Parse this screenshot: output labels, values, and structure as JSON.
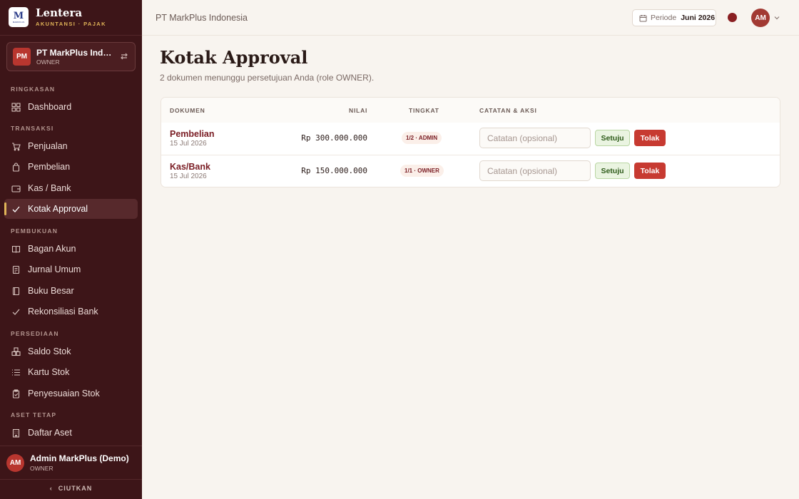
{
  "brand": {
    "logo_text": "M",
    "logo_sub": "MARKPLUS",
    "name": "Lentera",
    "subtitle": "AKUNTANSI · PAJAK"
  },
  "company": {
    "initials": "PM",
    "name": "PT MarkPlus Indonesia",
    "role": "OWNER"
  },
  "sidebar": {
    "sections": [
      {
        "label": "RINGKASAN",
        "items": [
          {
            "label": "Dashboard",
            "icon": "grid-icon"
          }
        ]
      },
      {
        "label": "TRANSAKSI",
        "items": [
          {
            "label": "Penjualan",
            "icon": "cart-icon"
          },
          {
            "label": "Pembelian",
            "icon": "bag-icon"
          },
          {
            "label": "Kas / Bank",
            "icon": "wallet-icon"
          },
          {
            "label": "Kotak Approval",
            "icon": "check-icon",
            "active": true
          }
        ]
      },
      {
        "label": "PEMBUKUAN",
        "items": [
          {
            "label": "Bagan Akun",
            "icon": "book-icon"
          },
          {
            "label": "Jurnal Umum",
            "icon": "document-icon"
          },
          {
            "label": "Buku Besar",
            "icon": "ledger-icon"
          },
          {
            "label": "Rekonsiliasi Bank",
            "icon": "check-icon"
          }
        ]
      },
      {
        "label": "PERSEDIAAN",
        "items": [
          {
            "label": "Saldo Stok",
            "icon": "boxes-icon"
          },
          {
            "label": "Kartu Stok",
            "icon": "list-icon"
          },
          {
            "label": "Penyesuaian Stok",
            "icon": "clipboard-icon"
          }
        ]
      },
      {
        "label": "ASET TETAP",
        "items": [
          {
            "label": "Daftar Aset",
            "icon": "building-icon"
          }
        ]
      }
    ]
  },
  "user": {
    "initials": "AM",
    "name": "Admin MarkPlus (Demo)",
    "role": "OWNER"
  },
  "collapse_label": "CIUTKAN",
  "header": {
    "title": "PT MarkPlus Indonesia",
    "period_label": "Periode",
    "period_value": "Juni 2026",
    "avatar_initials": "AM",
    "status_dot_color": "#8a1f22"
  },
  "main": {
    "title": "Kotak Approval",
    "subtitle": "2 dokumen menunggu persetujuan Anda (role OWNER).",
    "columns": {
      "doc": "DOKUMEN",
      "value": "NILAI",
      "level": "TINGKAT",
      "notes": "CATATAN & AKSI"
    },
    "rows": [
      {
        "name": "Pembelian",
        "date": "15 Jul 2026",
        "amount": "Rp 300.000.000",
        "level": "1/2 · ADMIN",
        "note_placeholder": "Catatan (opsional)",
        "approve": "Setuju",
        "reject": "Tolak"
      },
      {
        "name": "Kas/Bank",
        "date": "15 Jul 2026",
        "amount": "Rp 150.000.000",
        "level": "1/1 · OWNER",
        "note_placeholder": "Catatan (opsional)",
        "approve": "Setuju",
        "reject": "Tolak"
      }
    ]
  },
  "colors": {
    "sidebar": "#3d1518",
    "accent": "#e0b458",
    "danger": "#c73a31",
    "approve": "#eaf4e1"
  }
}
